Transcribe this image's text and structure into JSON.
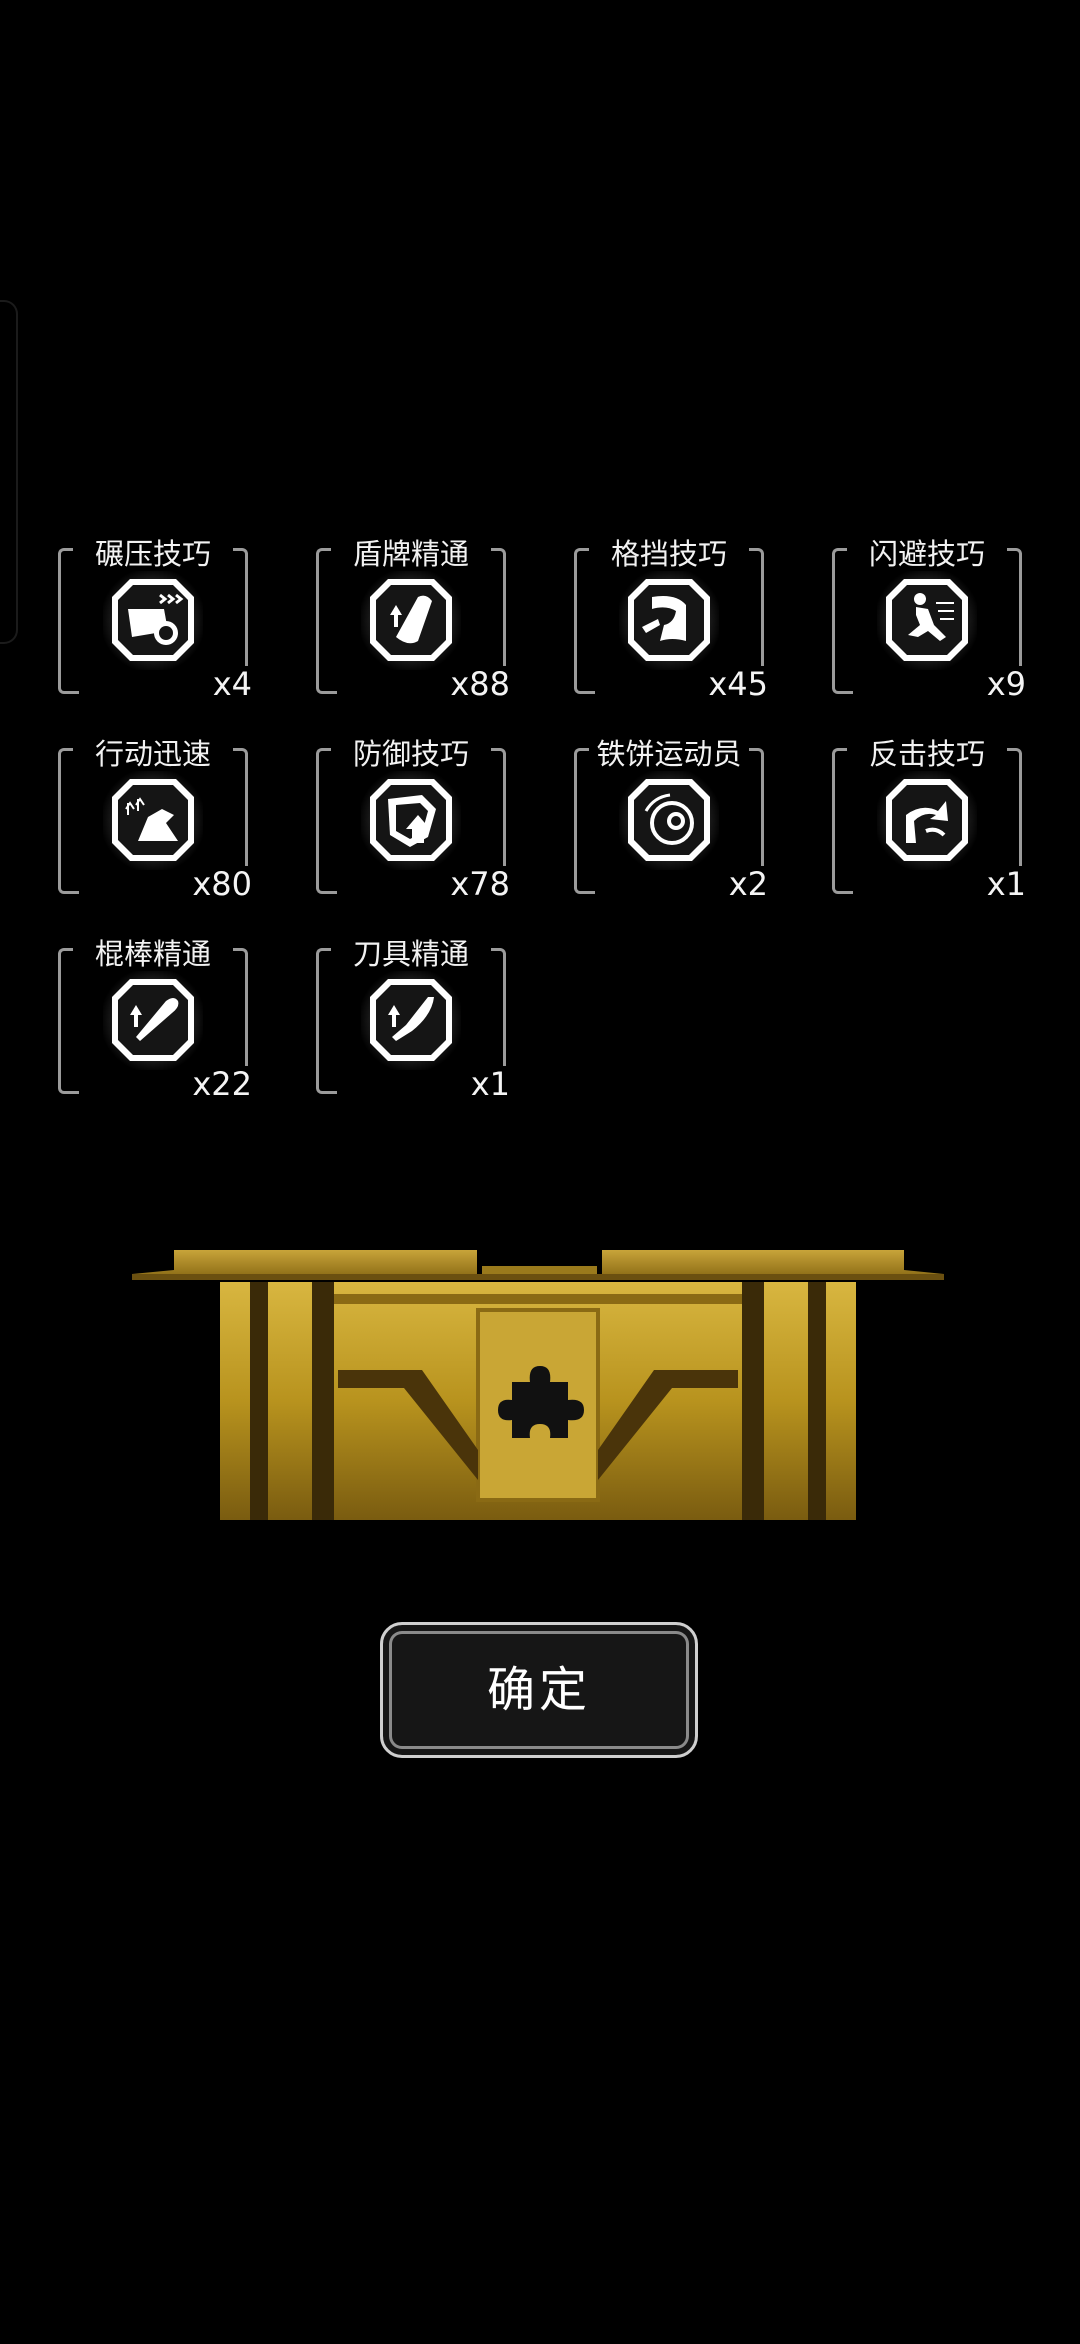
{
  "skills": [
    {
      "name": "盾牌精通",
      "count": "x88",
      "icon": "shield-mastery-icon"
    },
    {
      "name": "格挡技巧",
      "count": "x45",
      "icon": "parry-icon"
    },
    {
      "name": "碾压技巧",
      "count": "x4",
      "icon": "crush-icon"
    },
    {
      "name": "闪避技巧",
      "count": "x9",
      "icon": "dodge-icon"
    },
    {
      "name": "行动迅速",
      "count": "x80",
      "icon": "swift-action-icon"
    },
    {
      "name": "防御技巧",
      "count": "x78",
      "icon": "defense-icon"
    },
    {
      "name": "铁饼运动员",
      "count": "x2",
      "icon": "discus-thrower-icon"
    },
    {
      "name": "反击技巧",
      "count": "x1",
      "icon": "counterattack-icon"
    },
    {
      "name": "棍棒精通",
      "count": "x22",
      "icon": "club-mastery-icon"
    },
    {
      "name": "刀具精通",
      "count": "x1",
      "icon": "blade-mastery-icon"
    }
  ],
  "chest": {
    "icon": "puzzle-piece-icon",
    "color": "#c9a227"
  },
  "confirm_label": "确定"
}
